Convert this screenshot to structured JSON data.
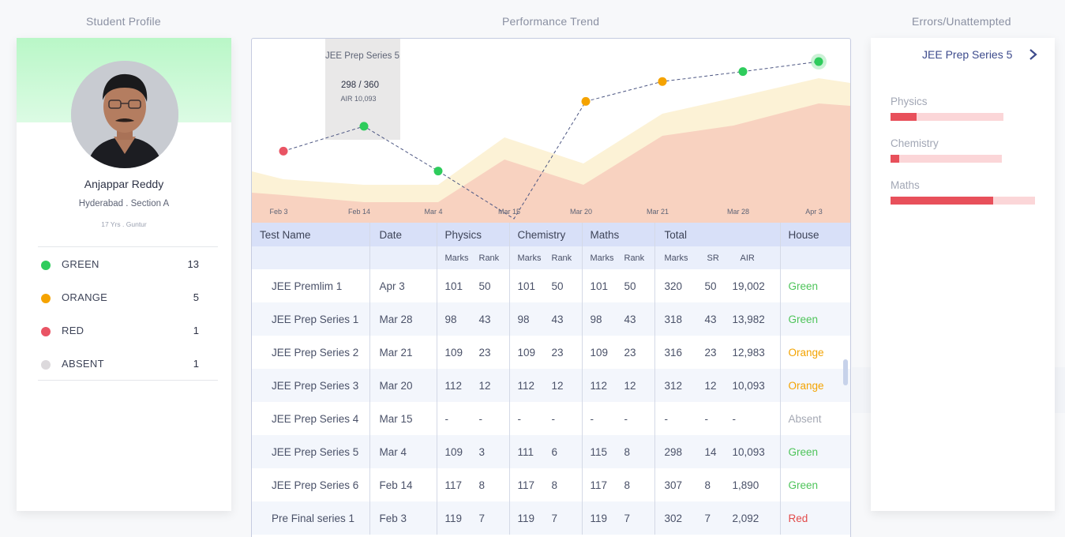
{
  "sections": {
    "profile_title": "Student Profile",
    "trend_title": "Performance Trend",
    "errors_title": "Errors/Unattempted"
  },
  "profile": {
    "name": "Anjappar Reddy",
    "location": "Hyderabad . Section A",
    "meta": "17 Yrs . Guntur",
    "houses": [
      {
        "label": "GREEN",
        "count": "13",
        "color": "#2ecc5c"
      },
      {
        "label": "ORANGE",
        "count": "5",
        "color": "#f5a300"
      },
      {
        "label": "RED",
        "count": "1",
        "color": "#e95464"
      },
      {
        "label": "ABSENT",
        "count": "1",
        "color": "#dcd9dc"
      }
    ]
  },
  "chart_data": {
    "type": "line",
    "x": [
      "Feb 3",
      "Feb 14",
      "Mar 4",
      "Mar 15",
      "Mar 20",
      "Mar 21",
      "Mar 28",
      "Apr 3"
    ],
    "series": [
      {
        "values": [
          302,
          307,
          298,
          null,
          312,
          316,
          318,
          320
        ]
      }
    ],
    "point_houses": [
      "Red",
      "Green",
      "Green",
      "Absent",
      "Orange",
      "Orange",
      "Green",
      "Green"
    ],
    "tooltip": {
      "title": "JEE Prep Series 5",
      "score": "298 / 360",
      "air": "AIR 10,093"
    },
    "colors": {
      "green": "#2ecc5c",
      "orange": "#f5a300",
      "red": "#e95464",
      "band_outer": "#fcf2d6",
      "band_inner": "#f8d2c0"
    }
  },
  "table": {
    "headers": {
      "test_name": "Test Name",
      "date": "Date",
      "physics": "Physics",
      "chemistry": "Chemistry",
      "maths": "Maths",
      "total": "Total",
      "house": "House",
      "marks": "Marks",
      "rank": "Rank",
      "sr": "SR",
      "air": "AIR"
    },
    "rows": [
      {
        "name": "JEE Premlim 1",
        "date": "Apr 3",
        "pm": "101",
        "pr": "50",
        "cm": "101",
        "cr": "50",
        "mm": "101",
        "mr": "50",
        "tm": "320",
        "sr": "50",
        "air": "19,002",
        "house": "Green"
      },
      {
        "name": "JEE Prep Series 1",
        "date": "Mar 28",
        "pm": "98",
        "pr": "43",
        "cm": "98",
        "cr": "43",
        "mm": "98",
        "mr": "43",
        "tm": "318",
        "sr": "43",
        "air": "13,982",
        "house": "Green"
      },
      {
        "name": "JEE Prep Series 2",
        "date": "Mar 21",
        "pm": "109",
        "pr": "23",
        "cm": "109",
        "cr": "23",
        "mm": "109",
        "mr": "23",
        "tm": "316",
        "sr": "23",
        "air": "12,983",
        "house": "Orange"
      },
      {
        "name": "JEE Prep Series 3",
        "date": "Mar 20",
        "pm": "112",
        "pr": "12",
        "cm": "112",
        "cr": "12",
        "mm": "112",
        "mr": "12",
        "tm": "312",
        "sr": "12",
        "air": "10,093",
        "house": "Orange"
      },
      {
        "name": "JEE Prep Series 4",
        "date": "Mar 15",
        "pm": "-",
        "pr": "-",
        "cm": "-",
        "cr": "-",
        "mm": "-",
        "mr": "-",
        "tm": "-",
        "sr": "-",
        "air": "-",
        "house": "Absent"
      },
      {
        "name": "JEE Prep Series 5",
        "date": "Mar 4",
        "pm": "109",
        "pr": "3",
        "cm": "111",
        "cr": "6",
        "mm": "115",
        "mr": "8",
        "tm": "298",
        "sr": "14",
        "air": "10,093",
        "house": "Green"
      },
      {
        "name": "JEE Prep Series 6",
        "date": "Feb 14",
        "pm": "117",
        "pr": "8",
        "cm": "117",
        "cr": "8",
        "mm": "117",
        "mr": "8",
        "tm": "307",
        "sr": "8",
        "air": "1,890",
        "house": "Green"
      },
      {
        "name": "Pre Final series 1",
        "date": "Feb 3",
        "pm": "119",
        "pr": "7",
        "cm": "119",
        "cr": "7",
        "mm": "119",
        "mr": "7",
        "tm": "302",
        "sr": "7",
        "air": "2,092",
        "house": "Red"
      }
    ]
  },
  "errors": {
    "test": "JEE Prep Series 5",
    "subjects": [
      {
        "label": "Physics",
        "error_fraction": 0.23
      },
      {
        "label": "Chemistry",
        "error_fraction": 0.08
      },
      {
        "label": "Maths",
        "error_fraction": 0.71
      }
    ]
  }
}
